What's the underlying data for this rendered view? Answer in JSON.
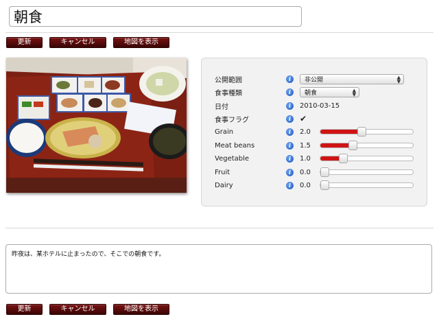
{
  "title": {
    "value": "朝食"
  },
  "buttons": {
    "update": "更新",
    "cancel": "キャンセル",
    "show_map": "地図を表示"
  },
  "fields": {
    "visibility": {
      "label": "公開範囲",
      "value": "非公開"
    },
    "meal_type": {
      "label": "食事種類",
      "value": "朝食"
    },
    "date": {
      "label": "日付",
      "value": "2010-03-15"
    },
    "meal_flag": {
      "label": "食事フラグ",
      "checked": true,
      "check_glyph": "✔"
    },
    "grain": {
      "label": "Grain",
      "value": "2.0",
      "fraction": 0.4
    },
    "meat_beans": {
      "label": "Meat beans",
      "value": "1.5",
      "fraction": 0.3
    },
    "vegetable": {
      "label": "Vegetable",
      "value": "1.0",
      "fraction": 0.2
    },
    "fruit": {
      "label": "Fruit",
      "value": "0.0",
      "fraction": 0
    },
    "dairy": {
      "label": "Dairy",
      "value": "0.0",
      "fraction": 0
    }
  },
  "icons": {
    "info": "i",
    "select_arrow_up": "▲",
    "select_arrow_down": "▼"
  },
  "comment": {
    "value": "昨夜は、某ホテルに止まったので、そこでの朝食です。"
  },
  "colors": {
    "button_bg": "#5a0a0a",
    "slider_fill": "#d01414",
    "info_icon": "#2a62cc"
  }
}
